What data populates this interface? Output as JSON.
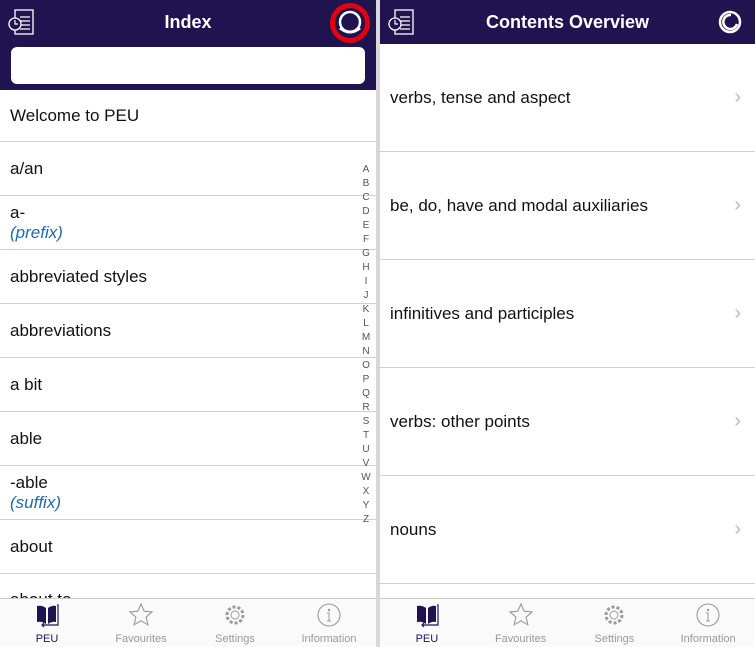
{
  "index": {
    "title": "Index",
    "search": {
      "value": "",
      "placeholder": ""
    },
    "items": [
      {
        "label": "Welcome to PEU"
      },
      {
        "label": "a/an"
      },
      {
        "label": "a-",
        "sub": "(prefix)"
      },
      {
        "label": "abbreviated styles"
      },
      {
        "label": "abbreviations"
      },
      {
        "label": "a bit"
      },
      {
        "label": "able"
      },
      {
        "label": "-able",
        "sub": "(suffix)"
      },
      {
        "label": "about"
      },
      {
        "label": "about to"
      }
    ],
    "alphabet": [
      "A",
      "B",
      "C",
      "D",
      "E",
      "F",
      "G",
      "H",
      "I",
      "J",
      "K",
      "L",
      "M",
      "N",
      "O",
      "P",
      "Q",
      "R",
      "S",
      "T",
      "U",
      "V",
      "W",
      "X",
      "Y",
      "Z"
    ]
  },
  "contents": {
    "title": "Contents Overview",
    "items": [
      "verbs, tense and aspect",
      "be, do, have and modal auxiliaries",
      "infinitives and participles",
      "verbs: other points",
      "nouns"
    ]
  },
  "tabs": [
    {
      "label": "PEU",
      "icon": "book-icon"
    },
    {
      "label": "Favourites",
      "icon": "star-icon"
    },
    {
      "label": "Settings",
      "icon": "gear-icon"
    },
    {
      "label": "Information",
      "icon": "info-icon"
    }
  ],
  "colors": {
    "header": "#1f1450",
    "link": "#2466b0",
    "highlight": "#e3000f"
  }
}
